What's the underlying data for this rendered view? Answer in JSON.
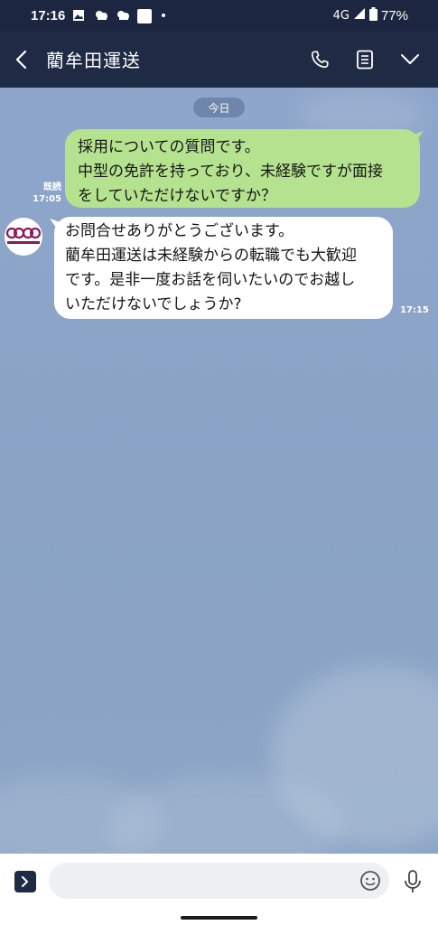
{
  "status_bar": {
    "time": "17:16",
    "network": "4G",
    "battery": "77%",
    "icons": [
      "image-icon",
      "cloud-icon",
      "cloud-icon",
      "square-icon",
      "dot-icon"
    ]
  },
  "header": {
    "title": "藺牟田運送",
    "icons": [
      "back-arrow-icon",
      "phone-icon",
      "notes-icon",
      "chevron-down-icon"
    ]
  },
  "chat": {
    "date_label": "今日",
    "messages": [
      {
        "direction": "outgoing",
        "lines": [
          "採用についての質問です。",
          "中型の免許を持っており、未経験ですが面接",
          "をしていただけないですか？"
        ],
        "read_label": "既読",
        "time": "17:05"
      },
      {
        "direction": "incoming",
        "lines": [
          "お問合せありがとうございます。",
          "藺牟田運送は未経験からの転職でも大歓迎",
          "です。是非一度お話を伺いたいのでお越し",
          "いただけないでしょうか?"
        ],
        "time": "17:15"
      }
    ]
  },
  "input": {
    "placeholder": "",
    "value": ""
  },
  "colors": {
    "header_bg": "#1f2a44",
    "chat_bg": "#8aa2c6",
    "outgoing_bubble": "#b5e28f",
    "incoming_bubble": "#ffffff",
    "avatar_logo": "#8b1a55"
  }
}
